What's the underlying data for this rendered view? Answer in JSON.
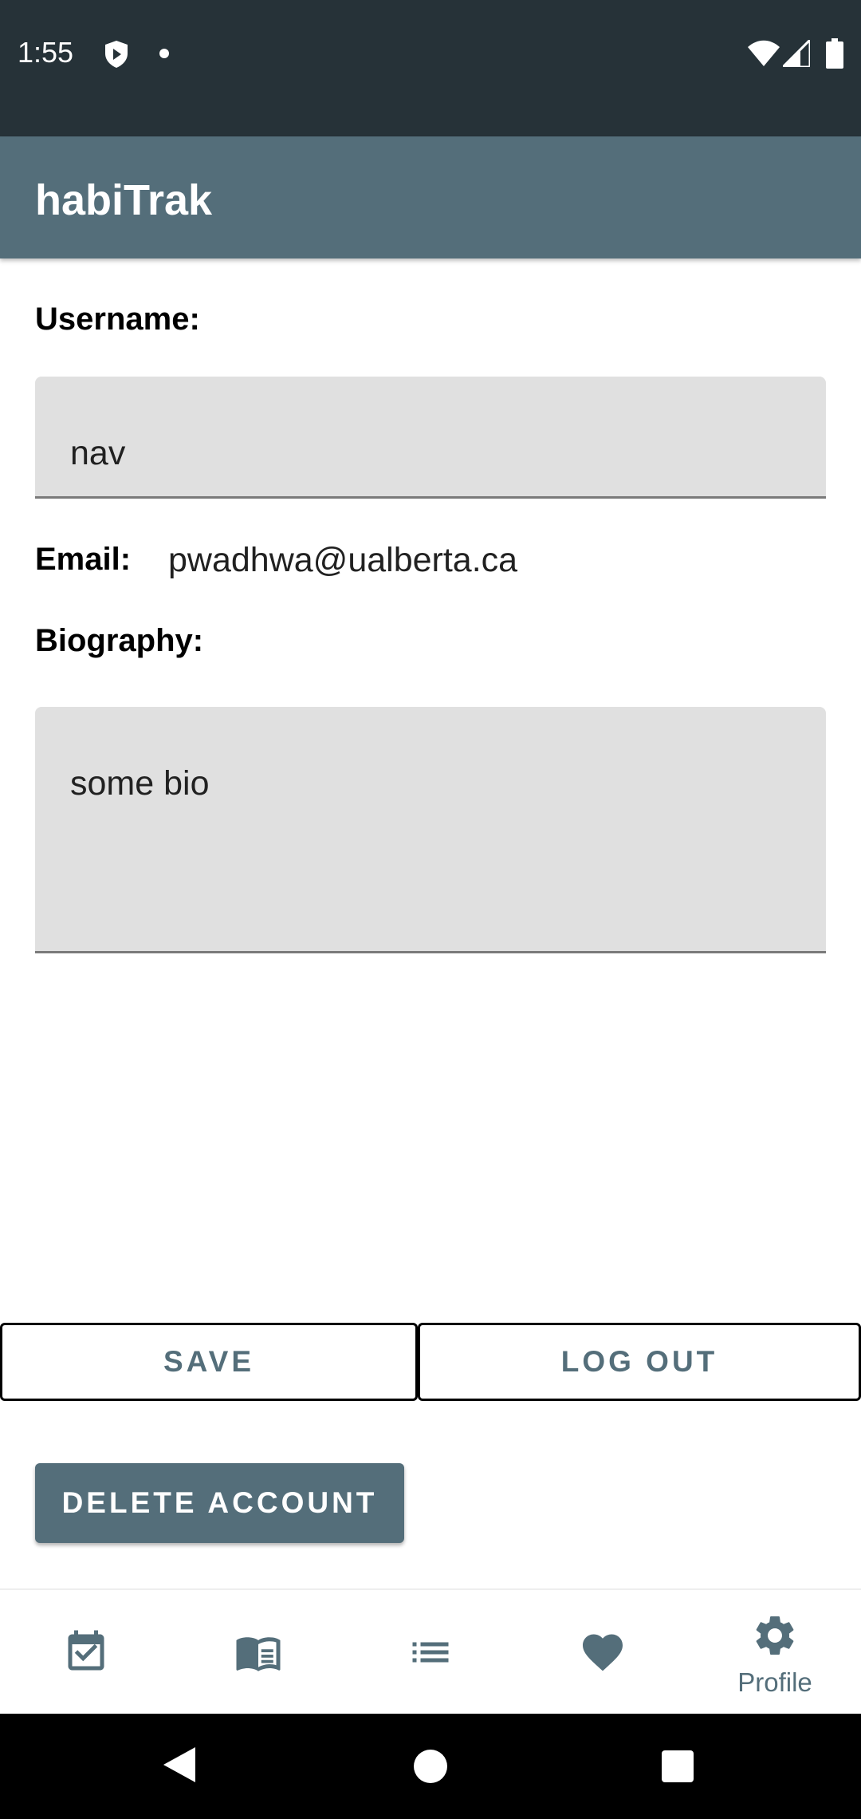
{
  "status_bar": {
    "time": "1:55",
    "icons": [
      "shield-icon",
      "notification-dot-icon",
      "wifi-icon",
      "signal-icon",
      "battery-icon"
    ]
  },
  "app_bar": {
    "title": "habiTrak",
    "color": "#546e7a"
  },
  "profile": {
    "username_label": "Username:",
    "username_value": "nav",
    "email_label": "Email:",
    "email_value": "pwadhwa@ualberta.ca",
    "biography_label": "Biography:",
    "biography_value": "some bio"
  },
  "actions": {
    "save_label": "SAVE",
    "logout_label": "LOG OUT",
    "delete_label": "DELETE ACCOUNT"
  },
  "bottom_nav": {
    "items": [
      {
        "icon": "calendar-check-icon",
        "label": ""
      },
      {
        "icon": "book-icon",
        "label": ""
      },
      {
        "icon": "list-icon",
        "label": ""
      },
      {
        "icon": "heart-icon",
        "label": ""
      },
      {
        "icon": "gear-icon",
        "label": "Profile",
        "active": true
      }
    ],
    "active_color": "#546e7a",
    "inactive_color": "#616161"
  },
  "system_nav": {
    "icons": [
      "back-icon",
      "home-icon",
      "recents-icon"
    ]
  }
}
